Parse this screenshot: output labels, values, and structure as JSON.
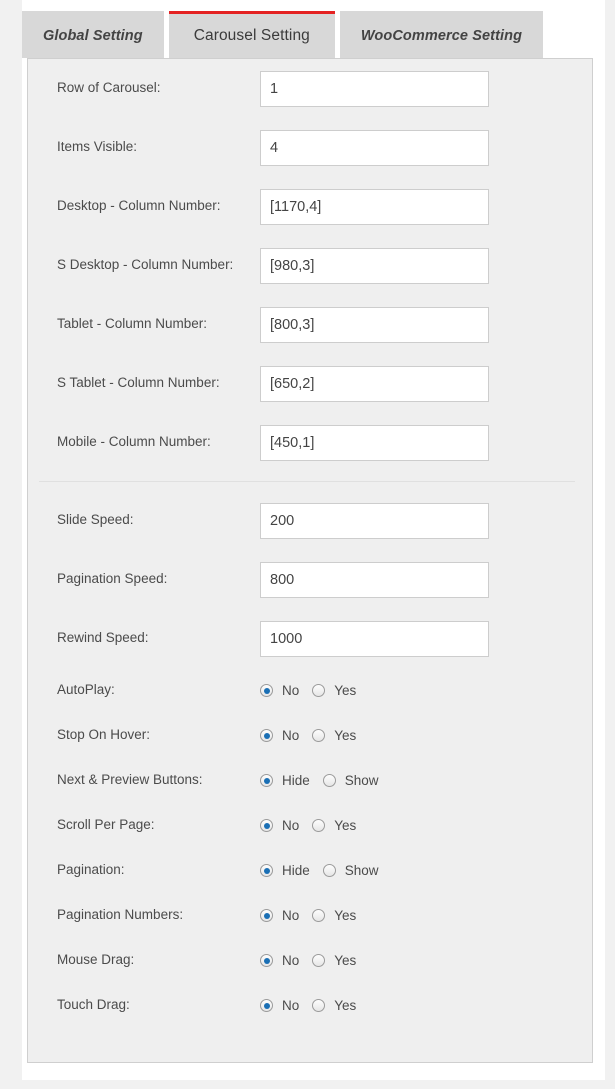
{
  "tabs": [
    {
      "label": "Global Setting",
      "active": false
    },
    {
      "label": "Carousel Setting",
      "active": true
    },
    {
      "label": "WooCommerce Setting",
      "active": false
    }
  ],
  "colors": {
    "accent_red": "#e42222",
    "radio_blue": "#1a6fb5",
    "panel_bg": "#efefef",
    "tab_bg": "#d8d8d8"
  },
  "text_fields": [
    {
      "label": "Row of Carousel:",
      "value": "1"
    },
    {
      "label": "Items Visible:",
      "value": "4"
    },
    {
      "label": "Desktop - Column Number:",
      "value": "[1170,4]"
    },
    {
      "label": "S Desktop - Column Number:",
      "value": "[980,3]"
    },
    {
      "label": "Tablet - Column Number:",
      "value": "[800,3]"
    },
    {
      "label": "S Tablet - Column Number:",
      "value": "[650,2]"
    },
    {
      "label": "Mobile - Column Number:",
      "value": "[450,1]"
    }
  ],
  "speed_fields": [
    {
      "label": "Slide Speed:",
      "value": "200"
    },
    {
      "label": "Pagination Speed:",
      "value": "800"
    },
    {
      "label": "Rewind Speed:",
      "value": "1000"
    }
  ],
  "radio_rows": [
    {
      "label": "AutoPlay:",
      "options": [
        "No",
        "Yes"
      ],
      "selected": 0
    },
    {
      "label": "Stop On Hover:",
      "options": [
        "No",
        "Yes"
      ],
      "selected": 0
    },
    {
      "label": "Next & Preview Buttons:",
      "options": [
        "Hide",
        "Show"
      ],
      "selected": 0
    },
    {
      "label": "Scroll Per Page:",
      "options": [
        "No",
        "Yes"
      ],
      "selected": 0
    },
    {
      "label": "Pagination:",
      "options": [
        "Hide",
        "Show"
      ],
      "selected": 0
    },
    {
      "label": "Pagination Numbers:",
      "options": [
        "No",
        "Yes"
      ],
      "selected": 0
    },
    {
      "label": "Mouse Drag:",
      "options": [
        "No",
        "Yes"
      ],
      "selected": 0
    },
    {
      "label": "Touch Drag:",
      "options": [
        "No",
        "Yes"
      ],
      "selected": 0
    }
  ]
}
